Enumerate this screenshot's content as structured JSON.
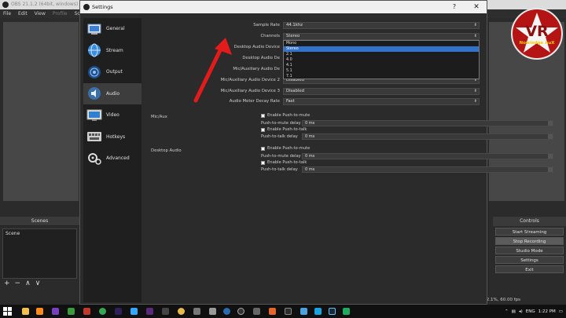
{
  "obs": {
    "title": "OBS 21.1.2 (64bit, windows) - P",
    "menu": [
      "File",
      "Edit",
      "View",
      "Profile",
      "Scen"
    ],
    "scenes_header": "Scenes",
    "scene_item": "Scene",
    "scenes_toolbar": [
      "+",
      "−",
      "∧",
      "∨"
    ],
    "controls_header": "Controls",
    "controls": [
      "Start Streaming",
      "Stop Recording",
      "Studio Mode",
      "Settings",
      "Exit"
    ],
    "status": "CPU: 12.1%, 60.00 fps"
  },
  "logo": {
    "big_text": "VR",
    "small_text": "Nowledge AuX"
  },
  "settings": {
    "title": "Settings",
    "help": "?",
    "close": "✕",
    "sidebar": [
      {
        "label": "General",
        "icon": "general-icon"
      },
      {
        "label": "Stream",
        "icon": "stream-icon"
      },
      {
        "label": "Output",
        "icon": "output-icon"
      },
      {
        "label": "Audio",
        "icon": "audio-icon",
        "selected": true
      },
      {
        "label": "Video",
        "icon": "video-icon"
      },
      {
        "label": "Hotkeys",
        "icon": "hotkeys-icon"
      },
      {
        "label": "Advanced",
        "icon": "advanced-icon"
      }
    ],
    "rows": {
      "sample_rate": {
        "label": "Sample Rate",
        "value": "44.1khz"
      },
      "channels": {
        "label": "Channels",
        "value": "Stereo"
      },
      "desktop1": {
        "label": "Desktop Audio Device",
        "value": ""
      },
      "desktop2": {
        "label": "Desktop Audio De",
        "value": ""
      },
      "mic1": {
        "label": "Mic/Auxiliary Audio De",
        "value": ""
      },
      "mic2": {
        "label": "Mic/Auxiliary Audio Device 2",
        "value": "Disabled"
      },
      "mic3": {
        "label": "Mic/Auxiliary Audio Device 3",
        "value": "Disabled"
      },
      "meter": {
        "label": "Audio Meter Decay Rate",
        "value": "Fast"
      }
    },
    "channels_options": [
      "Mono",
      "Stereo",
      "2.1",
      "4.0",
      "4.1",
      "5.1",
      "7.1"
    ],
    "channels_highlighted": "Stereo",
    "mic_aux": {
      "label": "Mic/Aux",
      "push_to_mute": "Enable Push-to-mute",
      "push_to_mute_delay": "Push-to-mute delay",
      "push_to_mute_value": "0 ms",
      "push_to_talk": "Enable Push-to-talk",
      "push_to_talk_delay": "Push-to-talk delay",
      "push_to_talk_value": "0 ms"
    },
    "desktop_audio": {
      "label": "Desktop Audio",
      "push_to_mute": "Enable Push-to-mute",
      "push_to_mute_delay": "Push-to-mute delay",
      "push_to_mute_value": "0 ms",
      "push_to_talk": "Enable Push-to-talk",
      "push_to_talk_delay": "Push-to-talk delay",
      "push_to_talk_value": "0 ms"
    }
  },
  "taskbar": {
    "time": "1:22 PM",
    "language": "ENG"
  },
  "colors": {
    "highlight": "#3272c9",
    "arrow": "#e31b1b",
    "dialog_bg": "#2b2b2b",
    "sidebar_bg": "#1f1f1f"
  }
}
